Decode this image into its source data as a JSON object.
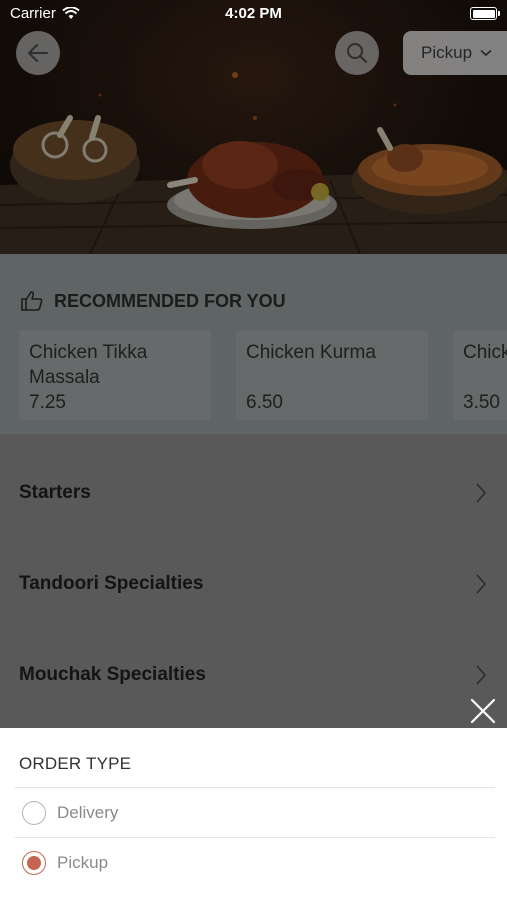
{
  "status_bar": {
    "carrier": "Carrier",
    "time": "4:02 PM"
  },
  "header": {
    "pickup_label": "Pickup",
    "icons": {
      "back": "arrow-left-icon",
      "search": "search-icon",
      "dropdown": "chevron-down-icon"
    }
  },
  "recommended": {
    "title": "RECOMMENDED FOR YOU",
    "icon": "thumbs-up-icon",
    "items": [
      {
        "name": "Chicken Tikka Massala",
        "price": "7.25"
      },
      {
        "name": "Chicken Kurma",
        "price": "6.50"
      },
      {
        "name": "Chicken Starter",
        "price": "3.50"
      }
    ]
  },
  "categories": [
    {
      "label": "Starters"
    },
    {
      "label": "Tandoori Specialties"
    },
    {
      "label": "Mouchak Specialties"
    }
  ],
  "order_type_sheet": {
    "title": "ORDER TYPE",
    "options": [
      {
        "label": "Delivery",
        "selected": false
      },
      {
        "label": "Pickup",
        "selected": true
      }
    ]
  },
  "colors": {
    "accent": "#c56650",
    "overlay": "#595959"
  }
}
